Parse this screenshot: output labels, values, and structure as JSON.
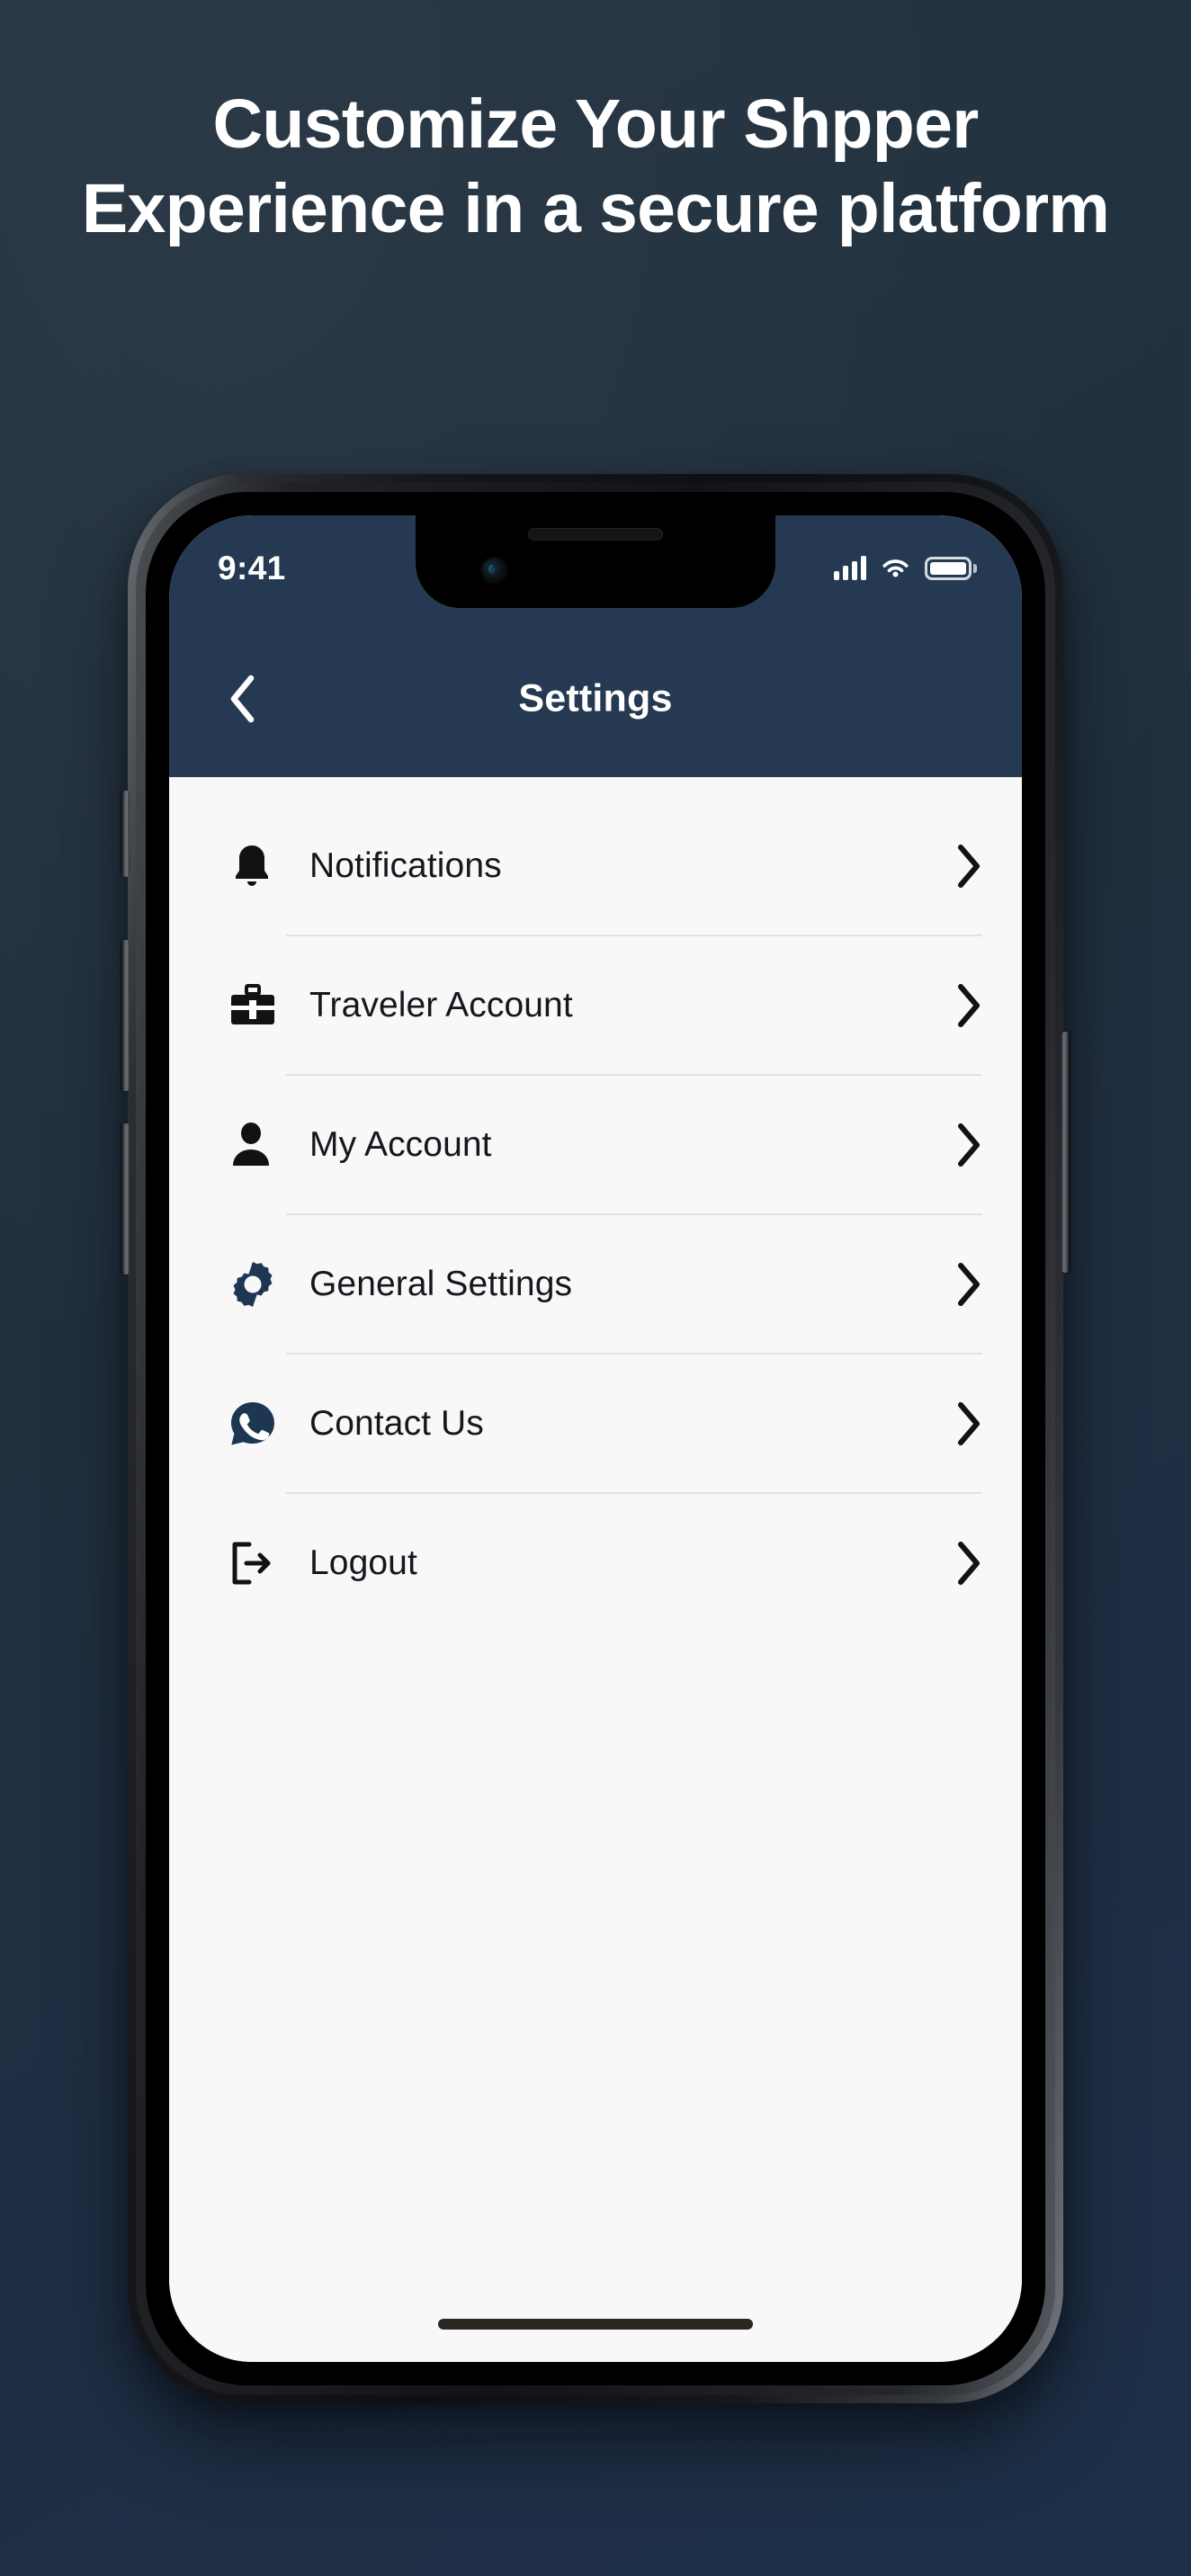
{
  "page": {
    "background_top_color": "#253340",
    "background_bottom_color": "#1e3049"
  },
  "headline": {
    "text": "Customize Your Shpper Experience in a secure platform",
    "color": "#ffffff"
  },
  "phone": {
    "status_bar": {
      "time": "9:41",
      "signal_icon": "cellular-signal-icon",
      "wifi_icon": "wifi-icon",
      "battery_icon": "battery-full-icon",
      "signal_bars": 4,
      "battery_level": 100
    },
    "nav_bar": {
      "back_icon": "chevron-left-icon",
      "title": "Settings",
      "background_color": "#253a52",
      "title_color": "#ffffff"
    },
    "settings_list": {
      "background_color": "#f8f8f8",
      "divider_color": "#e2e2e2",
      "items": [
        {
          "label": "Notifications",
          "icon": "bell-icon",
          "icon_color": "#101214",
          "chevron": "chevron-right-icon"
        },
        {
          "label": "Traveler Account",
          "icon": "briefcase-icon",
          "icon_color": "#101214",
          "chevron": "chevron-right-icon"
        },
        {
          "label": "My Account",
          "icon": "person-icon",
          "icon_color": "#101214",
          "chevron": "chevron-right-icon"
        },
        {
          "label": "General Settings",
          "icon": "gear-icon",
          "icon_color": "#1d3752",
          "chevron": "chevron-right-icon"
        },
        {
          "label": "Contact Us",
          "icon": "whatsapp-icon",
          "icon_color": "#1d3752",
          "chevron": "chevron-right-icon"
        },
        {
          "label": "Logout",
          "icon": "logout-icon",
          "icon_color": "#101214",
          "chevron": "chevron-right-icon"
        }
      ]
    },
    "home_indicator": "home-indicator",
    "side_buttons": [
      "silent-switch",
      "volume-up-button",
      "volume-down-button",
      "power-button"
    ]
  }
}
